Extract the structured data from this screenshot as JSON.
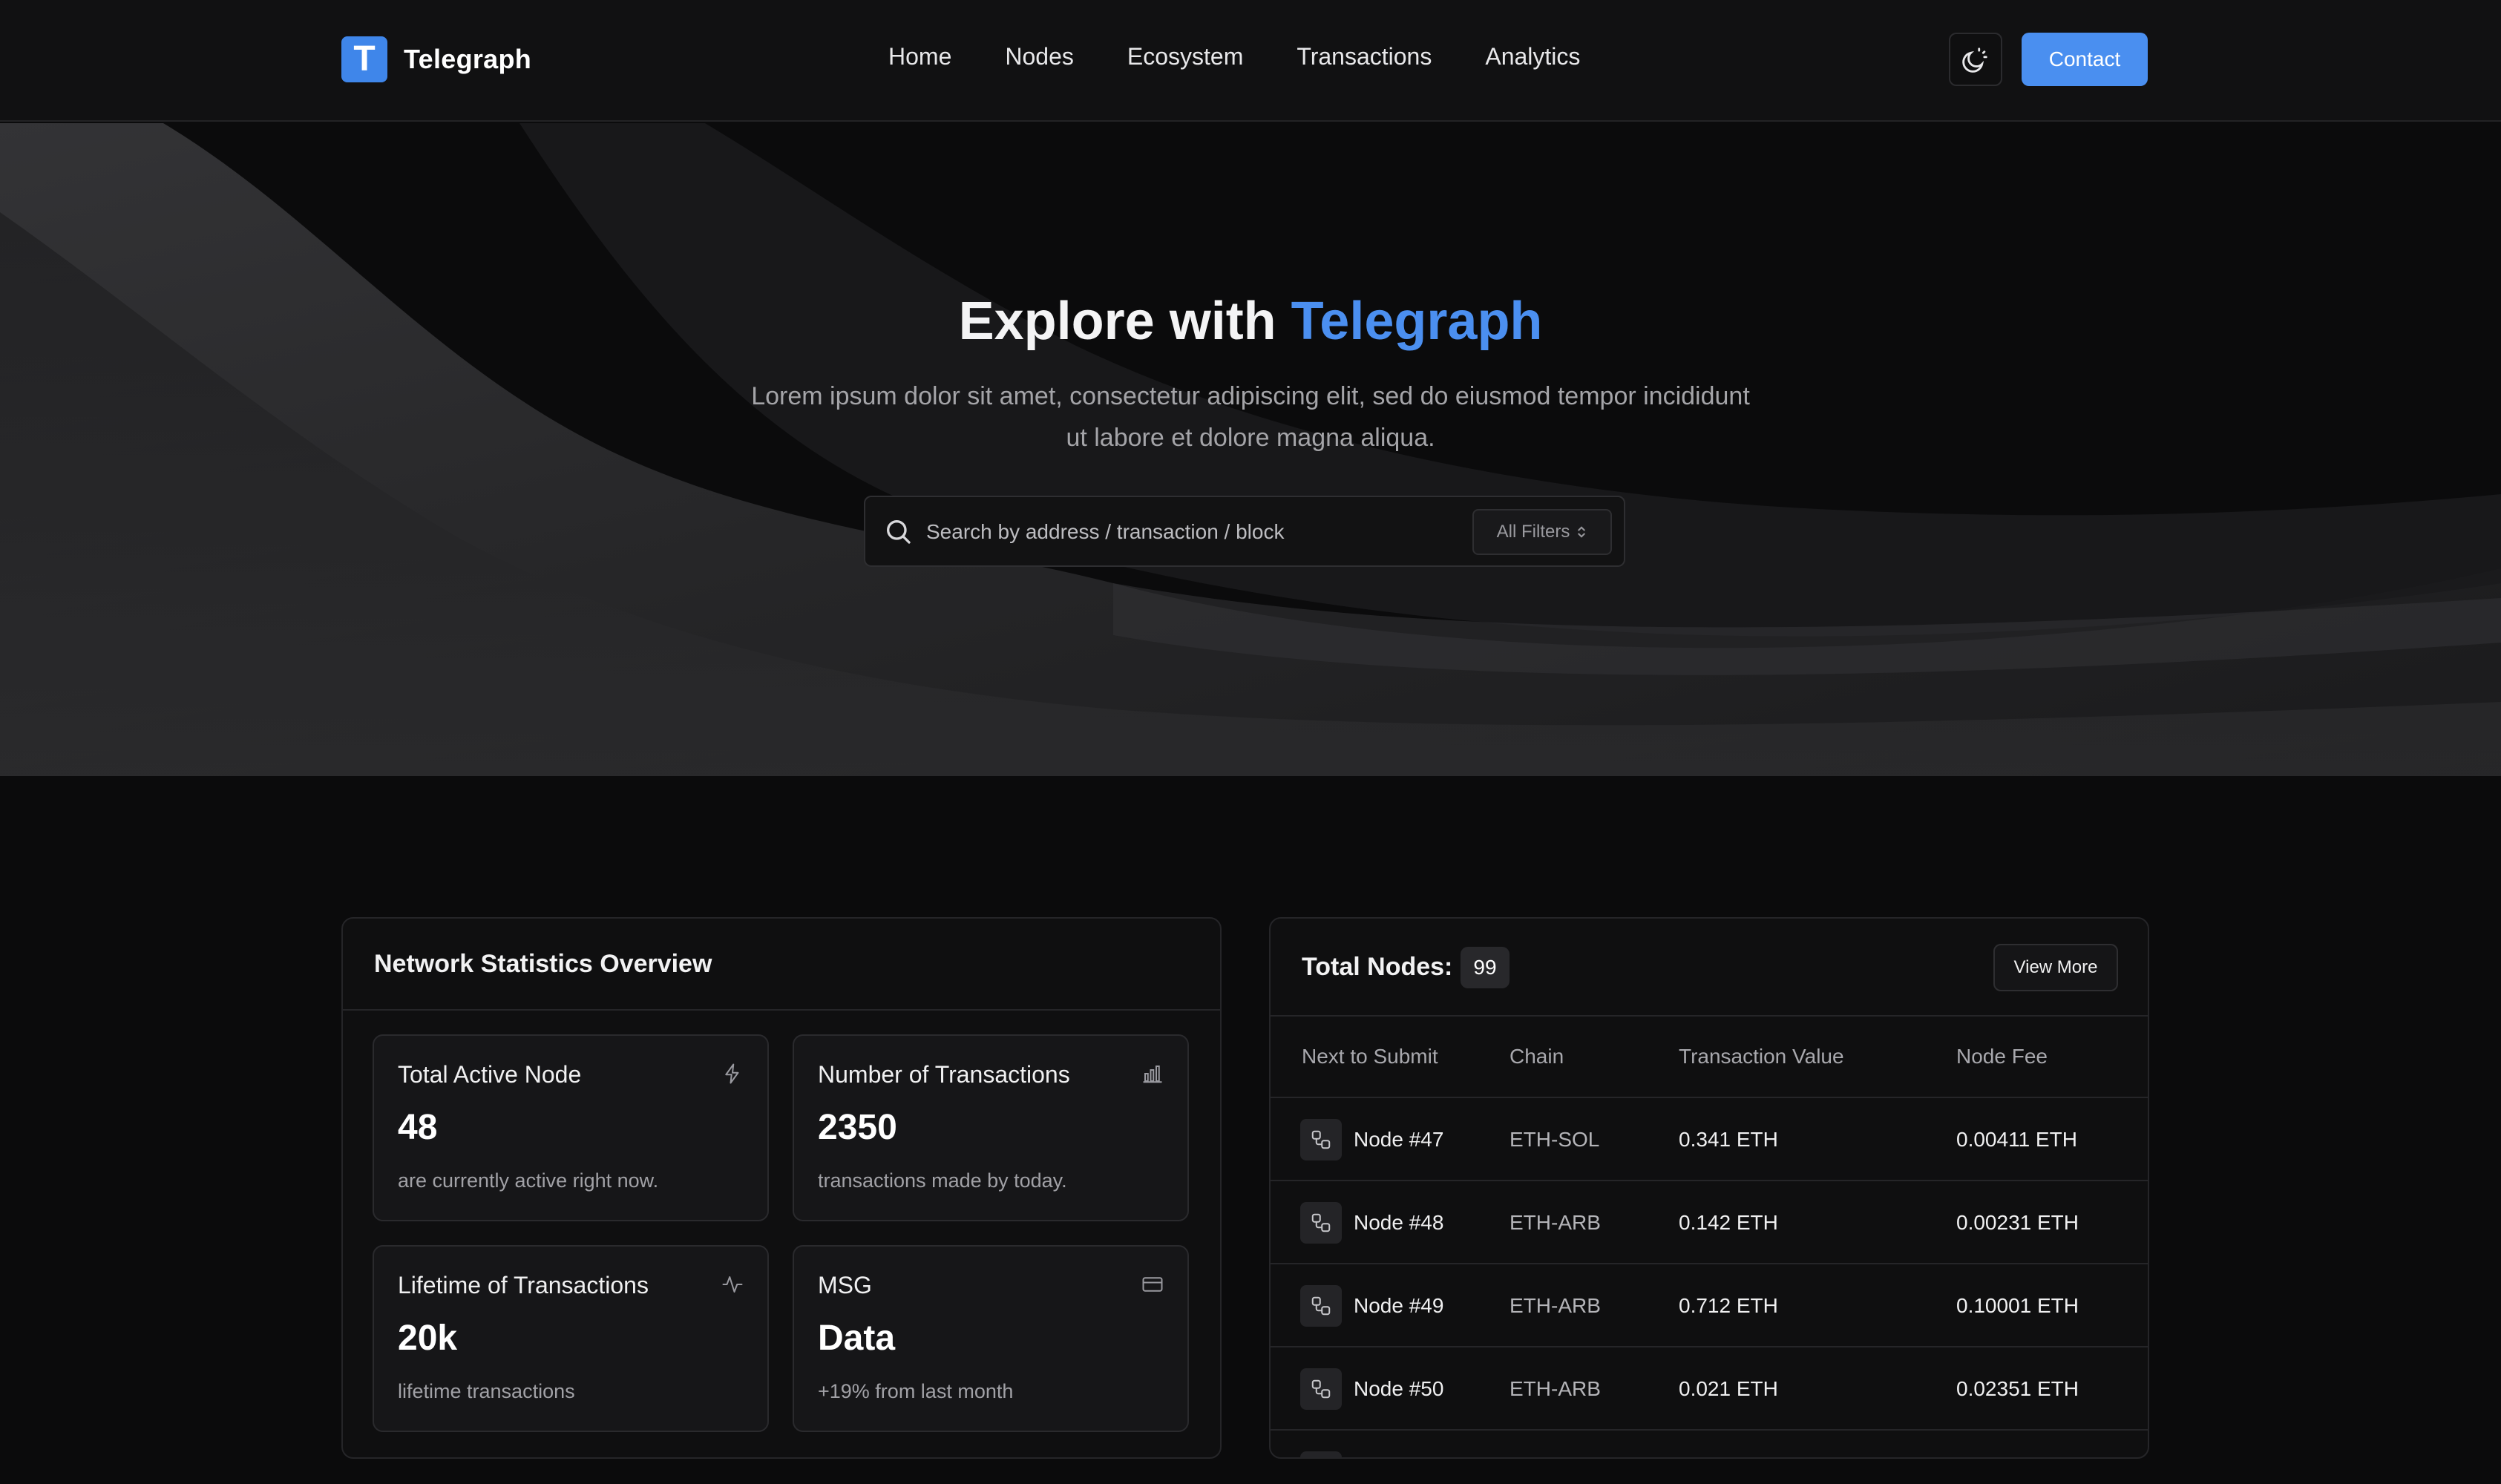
{
  "brand": {
    "logo_letter": "T",
    "name": "Telegraph",
    "accent_color": "#4a8ff0"
  },
  "nav": {
    "items": [
      "Home",
      "Nodes",
      "Ecosystem",
      "Transactions",
      "Analytics"
    ],
    "theme_toggle_icon": "moon-sun-icon",
    "contact_label": "Contact"
  },
  "hero": {
    "title_prefix": "Explore with ",
    "title_accent": "Telegraph",
    "subtitle": "Lorem ipsum dolor sit amet, consectetur adipiscing elit, sed do eiusmod tempor incididunt ut labore et dolore magna aliqua.",
    "search_placeholder": "Search by address / transaction / block",
    "filters_label": "All Filters"
  },
  "stats": {
    "title": "Network Statistics Overview",
    "cards": [
      {
        "label": "Total Active Node",
        "value": "48",
        "note": "are currently active right now.",
        "icon": "bolt-icon"
      },
      {
        "label": "Number of Transactions",
        "value": "2350",
        "note": "transactions made by today.",
        "icon": "bar-chart-icon"
      },
      {
        "label": "Lifetime of Transactions",
        "value": "20k",
        "note": "lifetime transactions",
        "icon": "activity-icon"
      },
      {
        "label": "MSG",
        "value": "Data",
        "note": "+19% from last month",
        "icon": "card-icon"
      }
    ]
  },
  "nodes": {
    "title": "Total Nodes:",
    "count": "99",
    "view_more_label": "View More",
    "columns": [
      "Next to Submit",
      "Chain",
      "Transaction Value",
      "Node Fee"
    ],
    "rows": [
      {
        "node": "Node #47",
        "chain": "ETH-SOL",
        "value": "0.341 ETH",
        "fee": "0.00411 ETH"
      },
      {
        "node": "Node #48",
        "chain": "ETH-ARB",
        "value": "0.142 ETH",
        "fee": "0.00231 ETH"
      },
      {
        "node": "Node #49",
        "chain": "ETH-ARB",
        "value": "0.712 ETH",
        "fee": "0.10001 ETH"
      },
      {
        "node": "Node #50",
        "chain": "ETH-ARB",
        "value": "0.021 ETH",
        "fee": "0.02351 ETH"
      }
    ]
  }
}
